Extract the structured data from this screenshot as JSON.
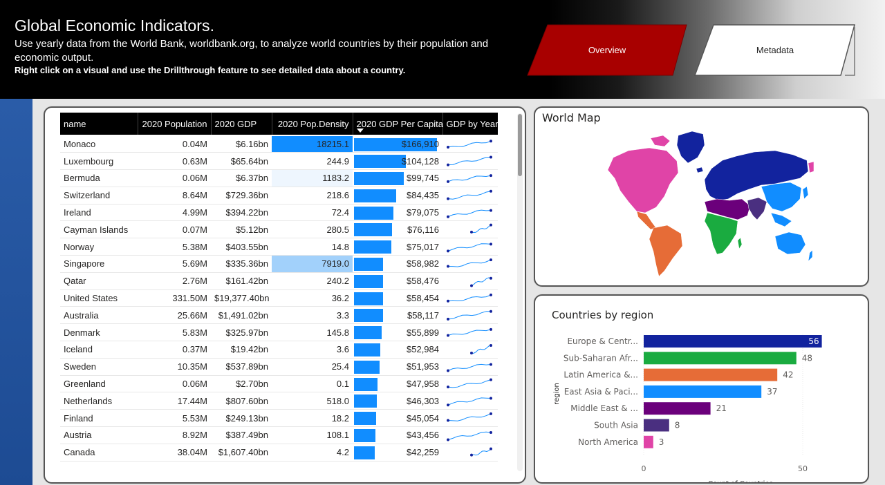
{
  "header": {
    "title": "Global Economic Indicators.",
    "description": "Use yearly data from the World Bank, worldbank.org, to analyze world countries by their population and economic output.",
    "hint": "Right click on a visual and use the Drillthrough feature to see detailed data about a country."
  },
  "nav": {
    "overview_label": "Overview",
    "metadata_label": "Metadata",
    "overview_color": "#a80000"
  },
  "table": {
    "columns": [
      "name",
      "2020 Population",
      "2020 GDP",
      "2020 Pop.Density",
      "2020 GDP Per Capita",
      "GDP by Year"
    ],
    "sorted_column": "2020 GDP Per Capita",
    "rows": [
      {
        "name": "Monaco",
        "pop": "0.04M",
        "gdp": "$6.16bn",
        "density": "18215.1",
        "per_capita": "$166,910",
        "per_capita_value": 166910,
        "density_value": 18215.1
      },
      {
        "name": "Luxembourg",
        "pop": "0.63M",
        "gdp": "$65.64bn",
        "density": "244.9",
        "per_capita": "$104,128",
        "per_capita_value": 104128,
        "density_value": 244.9
      },
      {
        "name": "Bermuda",
        "pop": "0.06M",
        "gdp": "$6.37bn",
        "density": "1183.2",
        "per_capita": "$99,745",
        "per_capita_value": 99745,
        "density_value": 1183.2
      },
      {
        "name": "Switzerland",
        "pop": "8.64M",
        "gdp": "$729.36bn",
        "density": "218.6",
        "per_capita": "$84,435",
        "per_capita_value": 84435,
        "density_value": 218.6
      },
      {
        "name": "Ireland",
        "pop": "4.99M",
        "gdp": "$394.22bn",
        "density": "72.4",
        "per_capita": "$79,075",
        "per_capita_value": 79075,
        "density_value": 72.4
      },
      {
        "name": "Cayman Islands",
        "pop": "0.07M",
        "gdp": "$5.12bn",
        "density": "280.5",
        "per_capita": "$76,116",
        "per_capita_value": 76116,
        "density_value": 280.5
      },
      {
        "name": "Norway",
        "pop": "5.38M",
        "gdp": "$403.55bn",
        "density": "14.8",
        "per_capita": "$75,017",
        "per_capita_value": 75017,
        "density_value": 14.8
      },
      {
        "name": "Singapore",
        "pop": "5.69M",
        "gdp": "$335.36bn",
        "density": "7919.0",
        "per_capita": "$58,982",
        "per_capita_value": 58982,
        "density_value": 7919.0
      },
      {
        "name": "Qatar",
        "pop": "2.76M",
        "gdp": "$161.42bn",
        "density": "240.2",
        "per_capita": "$58,476",
        "per_capita_value": 58476,
        "density_value": 240.2
      },
      {
        "name": "United States",
        "pop": "331.50M",
        "gdp": "$19,377.40bn",
        "density": "36.2",
        "per_capita": "$58,454",
        "per_capita_value": 58454,
        "density_value": 36.2
      },
      {
        "name": "Australia",
        "pop": "25.66M",
        "gdp": "$1,491.02bn",
        "density": "3.3",
        "per_capita": "$58,117",
        "per_capita_value": 58117,
        "density_value": 3.3
      },
      {
        "name": "Denmark",
        "pop": "5.83M",
        "gdp": "$325.97bn",
        "density": "145.8",
        "per_capita": "$55,899",
        "per_capita_value": 55899,
        "density_value": 145.8
      },
      {
        "name": "Iceland",
        "pop": "0.37M",
        "gdp": "$19.42bn",
        "density": "3.6",
        "per_capita": "$52,984",
        "per_capita_value": 52984,
        "density_value": 3.6
      },
      {
        "name": "Sweden",
        "pop": "10.35M",
        "gdp": "$537.89bn",
        "density": "25.4",
        "per_capita": "$51,953",
        "per_capita_value": 51953,
        "density_value": 25.4
      },
      {
        "name": "Greenland",
        "pop": "0.06M",
        "gdp": "$2.70bn",
        "density": "0.1",
        "per_capita": "$47,958",
        "per_capita_value": 47958,
        "density_value": 0.1
      },
      {
        "name": "Netherlands",
        "pop": "17.44M",
        "gdp": "$807.60bn",
        "density": "518.0",
        "per_capita": "$46,303",
        "per_capita_value": 46303,
        "density_value": 518.0
      },
      {
        "name": "Finland",
        "pop": "5.53M",
        "gdp": "$249.13bn",
        "density": "18.2",
        "per_capita": "$45,054",
        "per_capita_value": 45054,
        "density_value": 18.2
      },
      {
        "name": "Austria",
        "pop": "8.92M",
        "gdp": "$387.49bn",
        "density": "108.1",
        "per_capita": "$43,456",
        "per_capita_value": 43456,
        "density_value": 108.1
      },
      {
        "name": "Canada",
        "pop": "38.04M",
        "gdp": "$1,607.40bn",
        "density": "4.2",
        "per_capita": "$42,259",
        "per_capita_value": 42259,
        "density_value": 4.2
      }
    ]
  },
  "map": {
    "title": "World Map",
    "region_colors": {
      "north_america": "#e044a7",
      "latin_america": "#e66c37",
      "europe_central_asia": "#12239e",
      "sub_saharan_africa": "#1aab40",
      "middle_east": "#6b007b",
      "south_asia": "#4a2f80",
      "east_asia_pacific": "#118dff"
    }
  },
  "chart_data": {
    "type": "bar",
    "title": "Countries by region",
    "xlabel": "Count of Countries",
    "ylabel": "region",
    "categories": [
      "Europe & Centr...",
      "Sub-Saharan Afr...",
      "Latin America &...",
      "East Asia & Paci...",
      "Middle East & ...",
      "South Asia",
      "North America"
    ],
    "values": [
      56,
      48,
      42,
      37,
      21,
      8,
      3
    ],
    "colors": [
      "#12239e",
      "#1aab40",
      "#e66c37",
      "#118dff",
      "#6b007b",
      "#4a2f80",
      "#e044a7"
    ],
    "xticks": [
      "0",
      "50"
    ],
    "xlim": [
      0,
      60
    ]
  }
}
